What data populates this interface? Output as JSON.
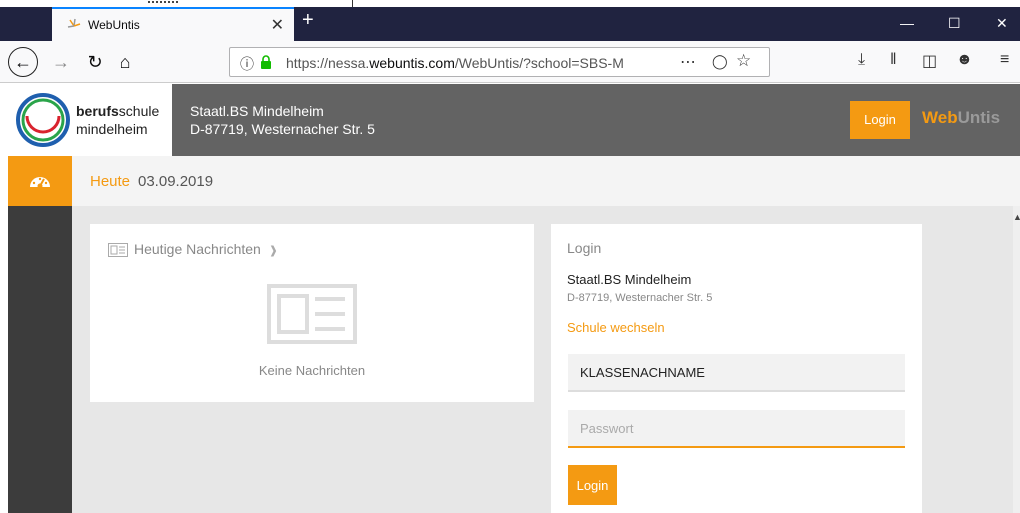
{
  "browser": {
    "tab_title": "WebUntis",
    "url_prefix": "https://nessa.",
    "url_domain": "webuntis.com",
    "url_path": "/WebUntis/?school=SBS-M",
    "accent": "#0a84ff"
  },
  "header": {
    "logo_bold": "berufs",
    "logo_rest": "schule",
    "logo_line2": "mindelheim",
    "school_name": "Staatl.BS Mindelheim",
    "school_address": "D-87719, Westernacher Str. 5",
    "login_label": "Login",
    "brand_web": "Web",
    "brand_untis": "Untis"
  },
  "datebar": {
    "today_label": "Heute",
    "date": "03.09.2019"
  },
  "news": {
    "title": "Heutige Nachrichten",
    "empty_text": "Keine Nachrichten"
  },
  "login": {
    "title": "Login",
    "school_name": "Staatl.BS Mindelheim",
    "school_address": "D-87719, Westernacher Str. 5",
    "change_school": "Schule wechseln",
    "username_value": "KLASSENACHNAME",
    "password_placeholder": "Passwort",
    "submit_label": "Login"
  },
  "colors": {
    "orange": "#f49a12",
    "header_gray": "#636363",
    "sidebar": "#3c3c3c"
  }
}
